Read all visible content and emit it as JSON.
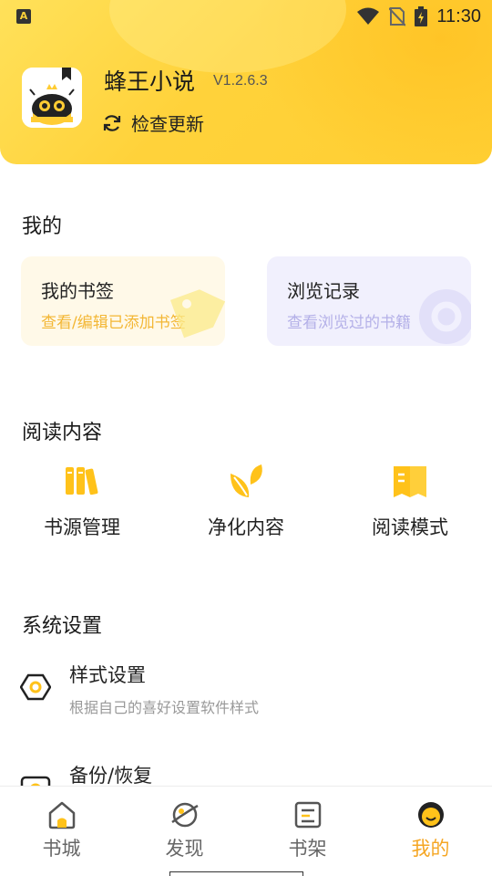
{
  "status_bar": {
    "time": "11:30",
    "left_icon": "A"
  },
  "app": {
    "name": "蜂王小说",
    "version": "V1.2.6.3",
    "update_label": "检查更新"
  },
  "mine": {
    "title": "我的",
    "bookmark": {
      "title": "我的书签",
      "subtitle": "查看/编辑已添加书签"
    },
    "history": {
      "title": "浏览记录",
      "subtitle": "查看浏览过的书籍"
    }
  },
  "reading": {
    "title": "阅读内容",
    "items": [
      {
        "label": "书源管理",
        "icon": "bookshelf-source-icon"
      },
      {
        "label": "净化内容",
        "icon": "leaf-icon"
      },
      {
        "label": "阅读模式",
        "icon": "open-book-icon"
      }
    ]
  },
  "settings": {
    "title": "系统设置",
    "items": [
      {
        "title": "样式设置",
        "desc": "根据自己的喜好设置软件样式",
        "icon": "hexagon-nut-icon"
      },
      {
        "title": "备份/恢复",
        "icon": "backup-icon"
      }
    ]
  },
  "bottom_nav": {
    "items": [
      {
        "label": "书城",
        "icon": "home-icon"
      },
      {
        "label": "发现",
        "icon": "planet-icon"
      },
      {
        "label": "书架",
        "icon": "bookshelf-icon"
      },
      {
        "label": "我的",
        "icon": "face-icon",
        "active": true
      }
    ]
  },
  "colors": {
    "accent": "#f5a623",
    "header": "#ffd23a"
  }
}
